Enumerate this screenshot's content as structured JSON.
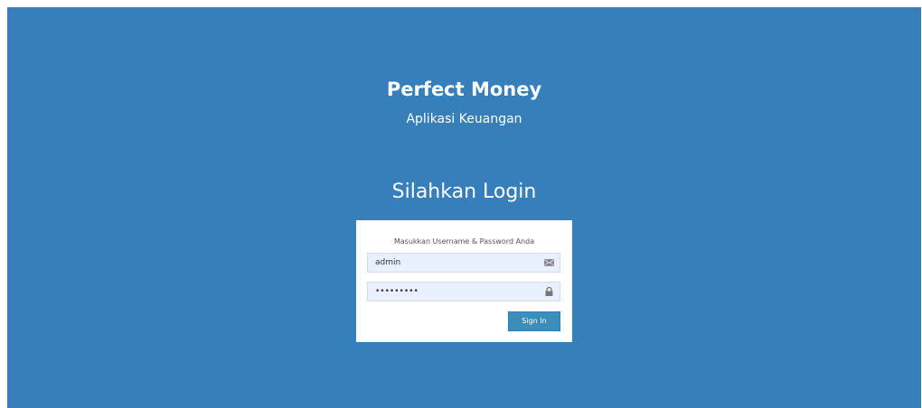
{
  "brand": {
    "title": "Perfect Money",
    "subtitle": "Aplikasi Keuangan"
  },
  "login": {
    "heading": "Silahkan Login",
    "message": "Masukkan Username & Password Anda",
    "username": {
      "value": "admin",
      "icon": "envelope-icon"
    },
    "password": {
      "value": "123456789",
      "icon": "lock-icon"
    },
    "signin_label": "Sign In"
  },
  "colors": {
    "background": "#367fbb",
    "button": "#3c8dbc",
    "field": "#e8f0fe"
  }
}
